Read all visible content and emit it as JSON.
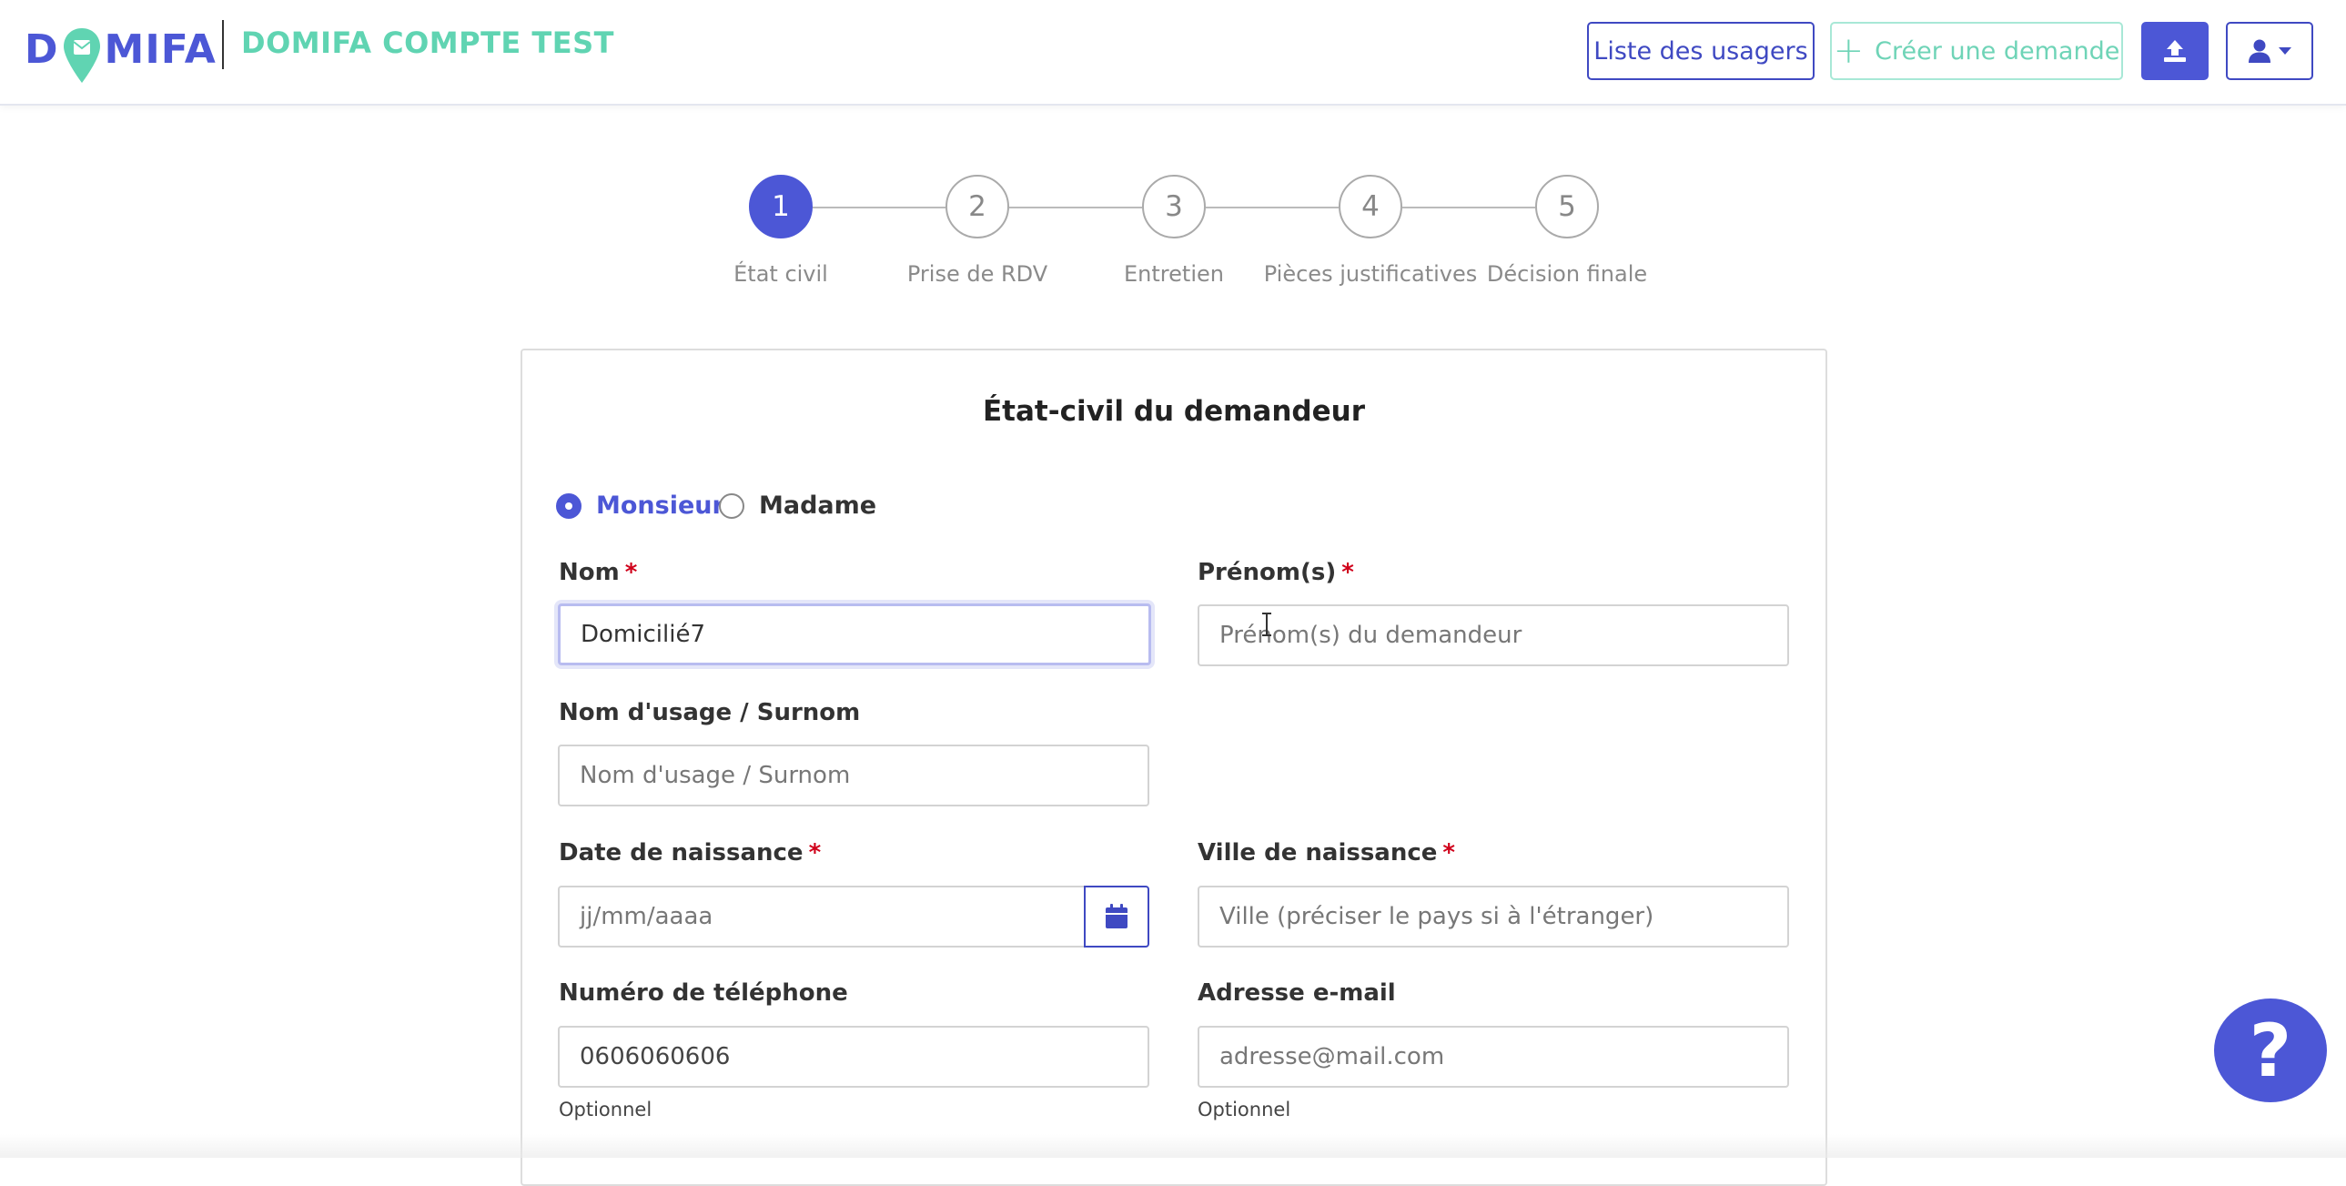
{
  "header": {
    "logo_text_left": "D",
    "logo_text_right": "MIFA",
    "org_name": "DOMIFA COMPTE TEST",
    "list_button": "Liste des usagers",
    "create_button": "Créer une demande",
    "create_icon": "plus-icon",
    "upload_icon": "upload-icon",
    "user_icon": "user-icon",
    "dropdown_icon": "caret-down-icon"
  },
  "stepper": {
    "steps": [
      {
        "number": "1",
        "label": "État civil",
        "active": true
      },
      {
        "number": "2",
        "label": "Prise de RDV",
        "active": false
      },
      {
        "number": "3",
        "label": "Entretien",
        "active": false
      },
      {
        "number": "4",
        "label": "Pièces justificatives",
        "active": false
      },
      {
        "number": "5",
        "label": "Décision finale",
        "active": false
      }
    ]
  },
  "form": {
    "title": "État-civil du demandeur",
    "civility": {
      "options": [
        "Monsieur",
        "Madame"
      ],
      "selected": "Monsieur"
    },
    "nom": {
      "label": "Nom",
      "required_mark": "*",
      "value": "Domicilié7"
    },
    "prenom": {
      "label": "Prénom(s)",
      "required_mark": "*",
      "placeholder": "Prénom(s) du demandeur"
    },
    "surnom": {
      "label": "Nom d'usage / Surnom",
      "placeholder": "Nom d'usage / Surnom"
    },
    "date_naissance": {
      "label": "Date de naissance",
      "required_mark": "*",
      "placeholder": "jj/mm/aaaa",
      "icon": "calendar-icon"
    },
    "ville_naissance": {
      "label": "Ville de naissance",
      "required_mark": "*",
      "placeholder": "Ville (préciser le pays si à l'étranger)"
    },
    "telephone": {
      "label": "Numéro de téléphone",
      "value": "0606060606",
      "hint": "Optionnel"
    },
    "email": {
      "label": "Adresse e-mail",
      "placeholder": "adresse@mail.com",
      "hint": "Optionnel"
    }
  },
  "help": {
    "label": "?"
  },
  "colors": {
    "primary": "#4c57d6",
    "accent_green": "#60d4b2",
    "required": "#d0021b"
  }
}
